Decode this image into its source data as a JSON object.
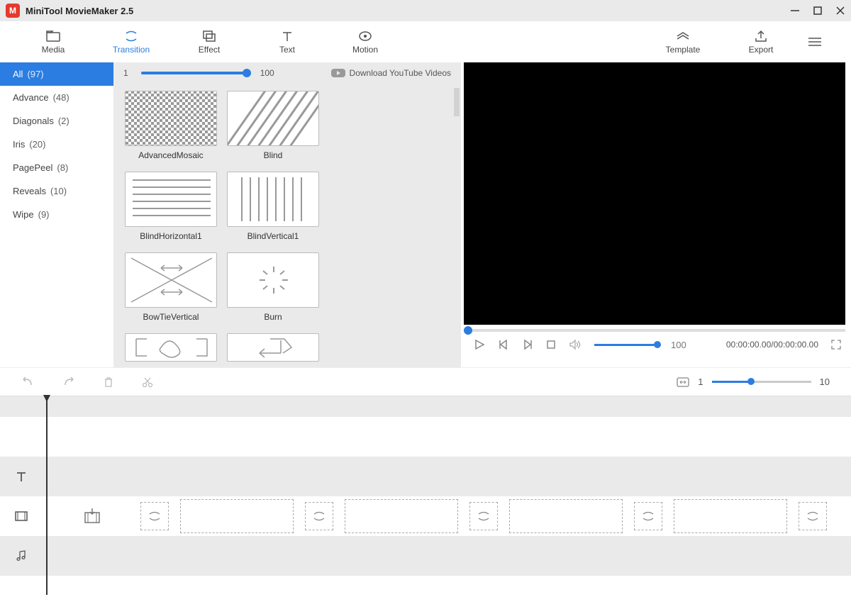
{
  "app": {
    "title": "MiniTool MovieMaker 2.5"
  },
  "toolbar": {
    "media": "Media",
    "transition": "Transition",
    "effect": "Effect",
    "text": "Text",
    "motion": "Motion",
    "template": "Template",
    "export": "Export"
  },
  "sidebar": {
    "items": [
      {
        "label": "All",
        "count": "(97)"
      },
      {
        "label": "Advance",
        "count": "(48)"
      },
      {
        "label": "Diagonals",
        "count": "(2)"
      },
      {
        "label": "Iris",
        "count": "(20)"
      },
      {
        "label": "PagePeel",
        "count": "(8)"
      },
      {
        "label": "Reveals",
        "count": "(10)"
      },
      {
        "label": "Wipe",
        "count": "(9)"
      }
    ]
  },
  "grid": {
    "slider_min": "1",
    "slider_max": "100",
    "download_label": "Download YouTube Videos",
    "items": [
      {
        "name": "AdvancedMosaic"
      },
      {
        "name": "Blind"
      },
      {
        "name": "BlindHorizontal1"
      },
      {
        "name": "BlindVertical1"
      },
      {
        "name": "BowTieVertical"
      },
      {
        "name": "Burn"
      }
    ]
  },
  "preview": {
    "volume_value": "100",
    "timecode": "00:00:00.00/00:00:00.00"
  },
  "zoom": {
    "min": "1",
    "max": "10"
  }
}
